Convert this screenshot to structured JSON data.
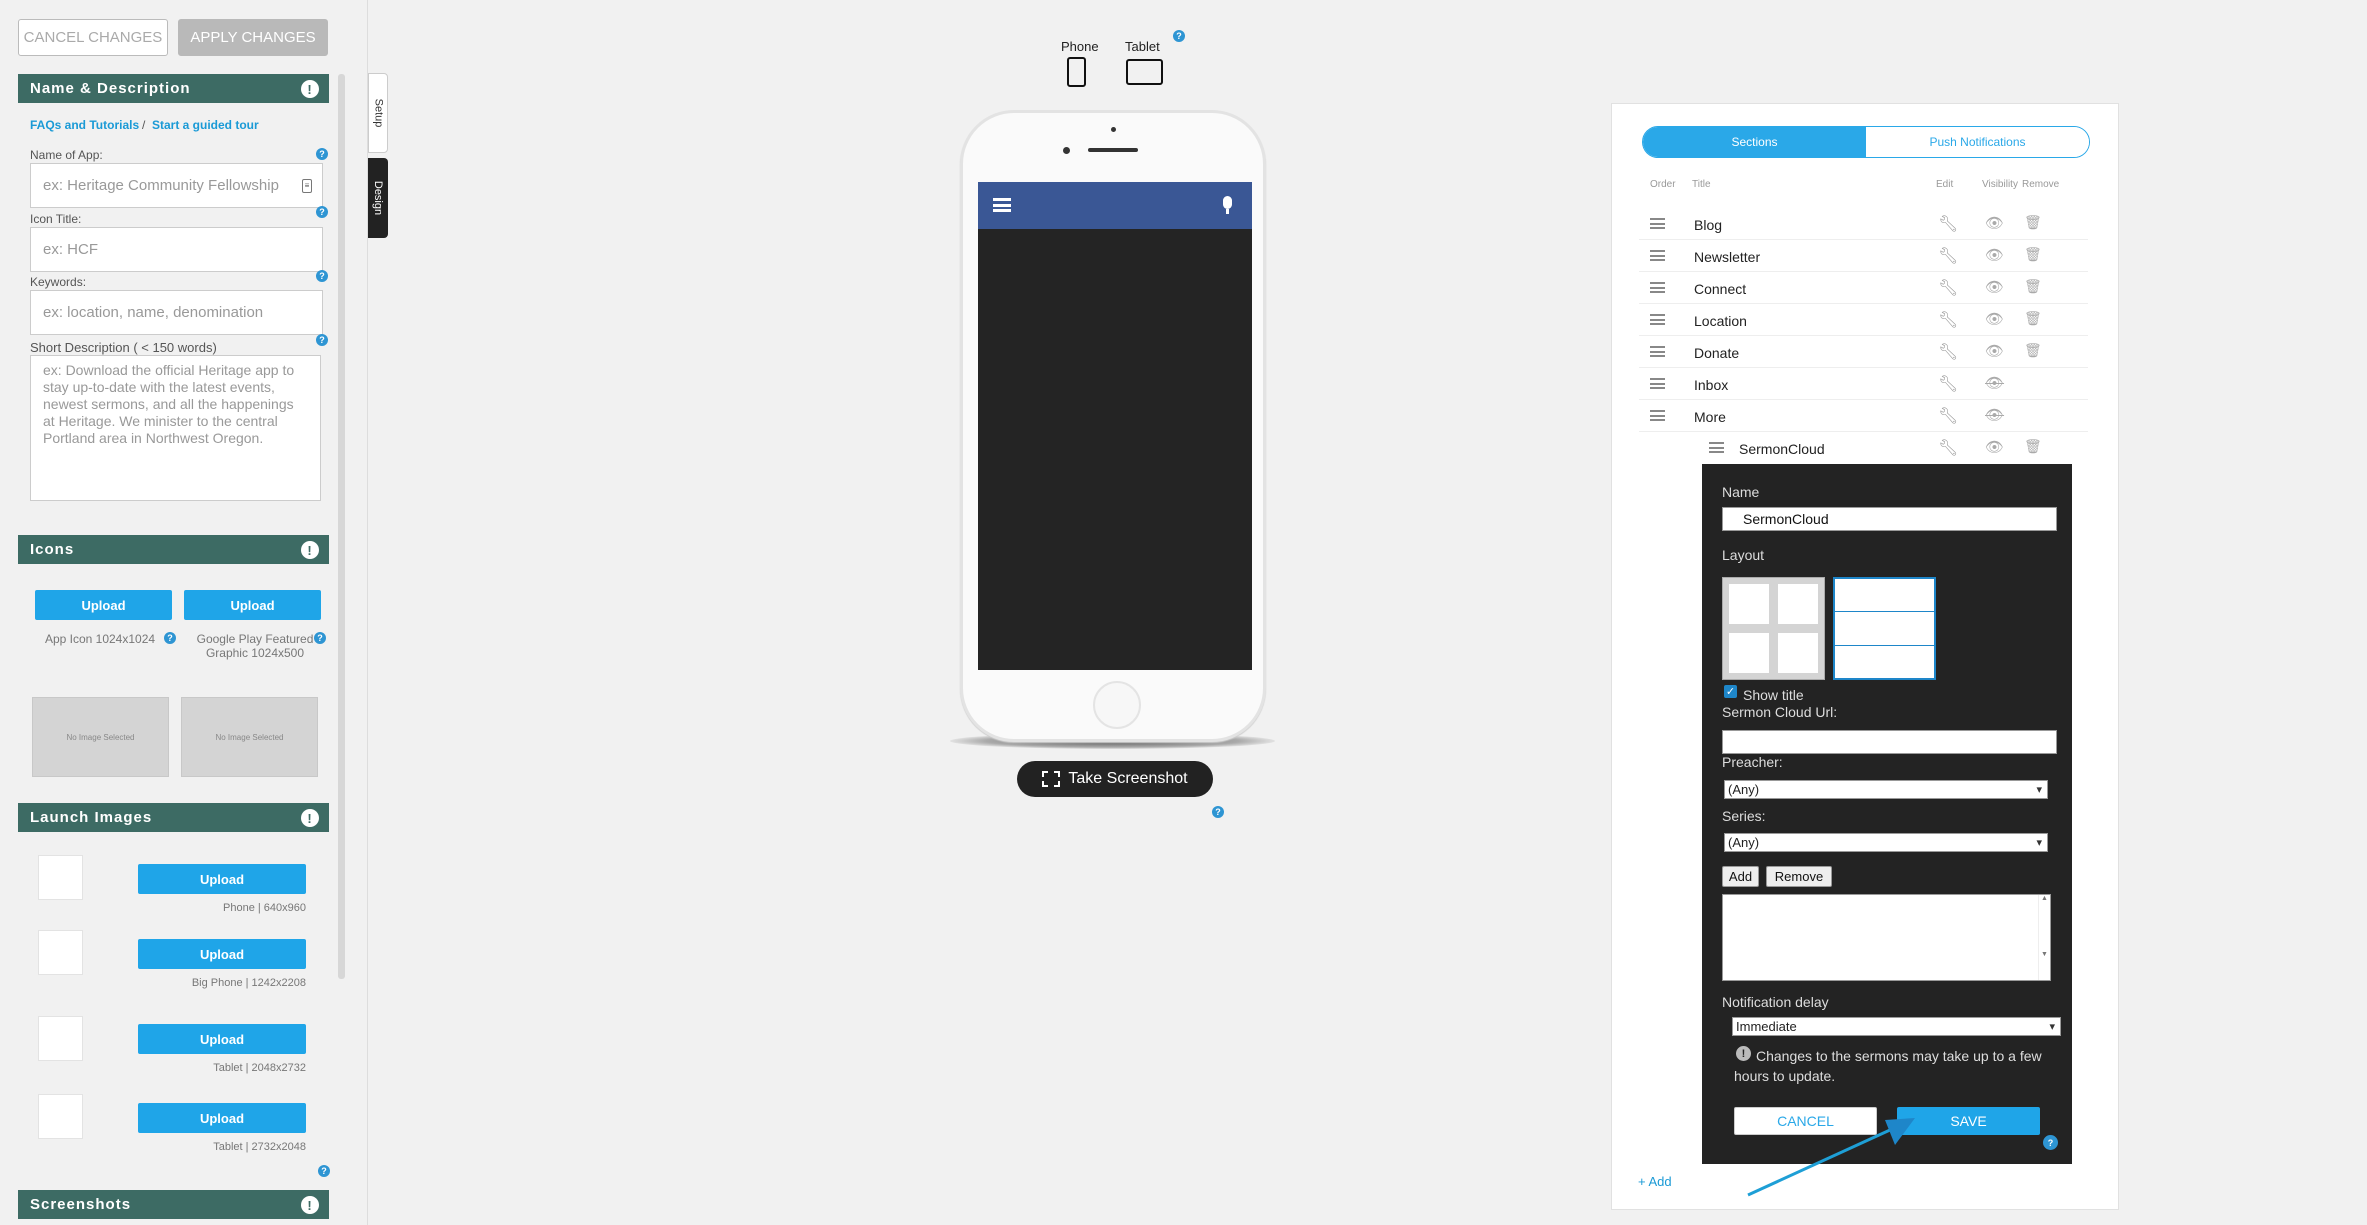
{
  "toolbar": {
    "cancel_label": "CANCEL CHANGES",
    "apply_label": "APPLY CHANGES"
  },
  "left": {
    "name_section": "Name & Description",
    "faq_link": "FAQs and Tutorials",
    "slash": "/",
    "tour_link": "Start a guided tour",
    "name_label": "Name of App:",
    "name_placeholder": "ex: Heritage Community Fellowship",
    "icon_title_label": "Icon Title:",
    "icon_title_placeholder": "ex: HCF",
    "keywords_label": "Keywords:",
    "keywords_placeholder": "ex: location, name, denomination",
    "short_desc_label": "Short Description ( < 150 words)",
    "short_desc_placeholder": "ex: Download the official Heritage app to stay up-to-date with the latest events, newest sermons, and all the happenings at Heritage. We minister to the central Portland area in Northwest Oregon.",
    "icons_section": "Icons",
    "upload_label": "Upload",
    "app_icon_caption": "App Icon 1024x1024",
    "google_caption": "Google Play Featured Graphic 1024x500",
    "no_image": "No Image Selected",
    "launch_section": "Launch Images",
    "launch_items": [
      {
        "caption": "Phone | 640x960"
      },
      {
        "caption": "Big Phone | 1242x2208"
      },
      {
        "caption": "Tablet | 2048x2732"
      },
      {
        "caption": "Tablet | 2732x2048"
      }
    ],
    "screenshots_section": "Screenshots",
    "alert_glyph": "!",
    "help_glyph": "?"
  },
  "side_tabs": {
    "setup": "Setup",
    "design": "Design"
  },
  "preview": {
    "phone_label": "Phone",
    "tablet_label": "Tablet",
    "screenshot_label": "Take Screenshot",
    "header_color": "#3a5795"
  },
  "right": {
    "tab_sections": "Sections",
    "tab_push": "Push Notifications",
    "col_order": "Order",
    "col_title": "Title",
    "col_edit": "Edit",
    "col_visibility": "Visibility",
    "col_remove": "Remove",
    "rows": [
      {
        "name": "Blog",
        "visible": true,
        "removable": true
      },
      {
        "name": "Newsletter",
        "visible": true,
        "removable": true
      },
      {
        "name": "Connect",
        "visible": true,
        "removable": true
      },
      {
        "name": "Location",
        "visible": true,
        "removable": true
      },
      {
        "name": "Donate",
        "visible": true,
        "removable": true
      },
      {
        "name": "Inbox",
        "visible": false,
        "removable": false
      },
      {
        "name": "More",
        "visible": false,
        "removable": false
      }
    ],
    "sub_row": "SermonCloud",
    "add_link": "+ Add"
  },
  "editor": {
    "name_label": "Name",
    "name_value": "SermonCloud",
    "layout_label": "Layout",
    "show_title_label": "Show title",
    "show_title_checked": true,
    "url_label": "Sermon Cloud Url:",
    "preacher_label": "Preacher:",
    "preacher_value": "(Any)",
    "series_label": "Series:",
    "series_value": "(Any)",
    "add_btn": "Add",
    "remove_btn": "Remove",
    "delay_label": "Notification delay",
    "delay_value": "Immediate",
    "note": "Changes to the sermons may take up to a few hours to update.",
    "cancel_btn": "CANCEL",
    "save_btn": "SAVE"
  },
  "colors": {
    "accent": "#2aa8e8",
    "section_header": "#3d6b64",
    "editor_bg": "#232323"
  }
}
